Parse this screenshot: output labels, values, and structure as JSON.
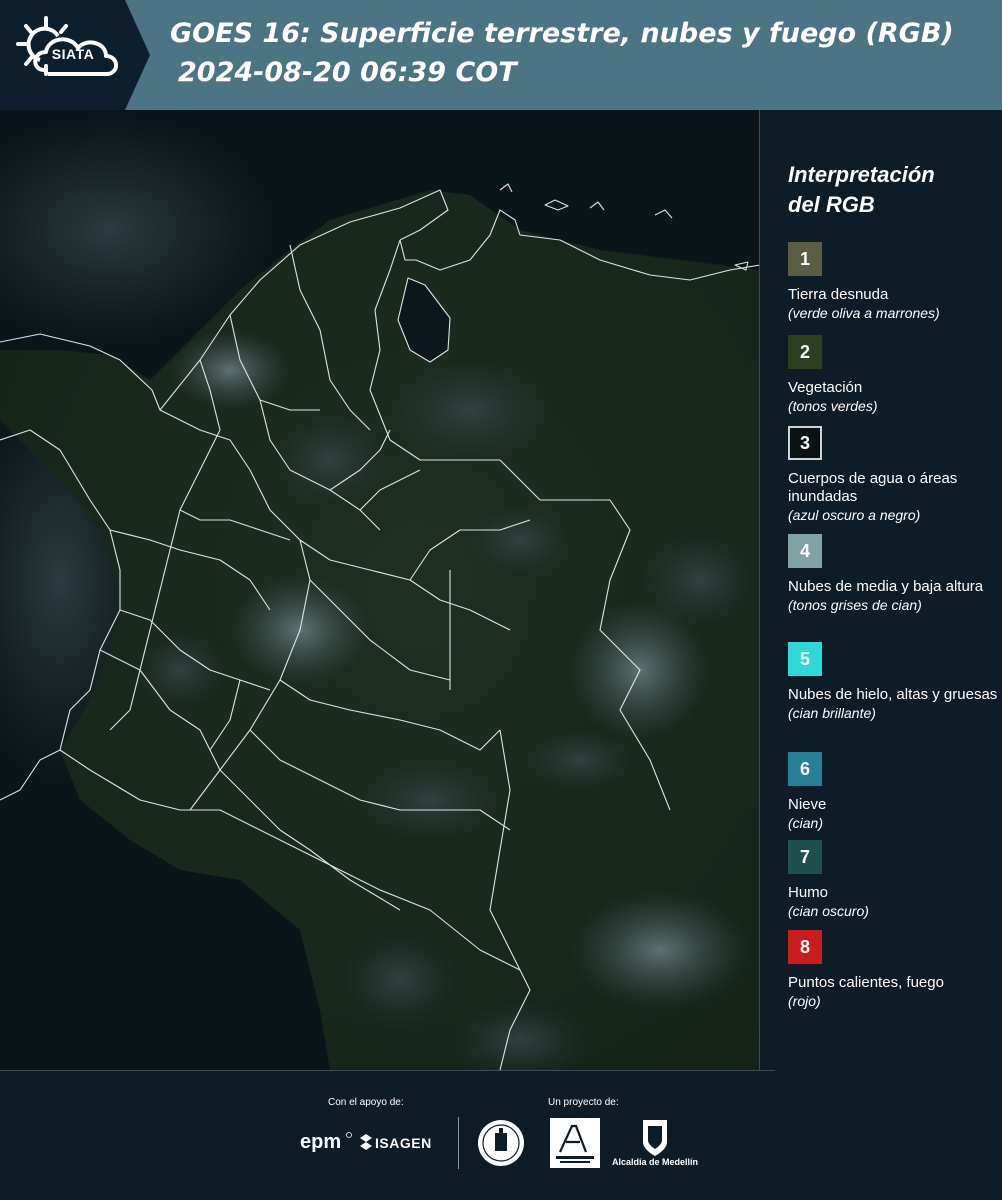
{
  "header": {
    "logo_text": "SIATA",
    "title": "GOES 16: Superficie terrestre, nubes y fuego (RGB)",
    "datetime": "2024-08-20 06:39 COT"
  },
  "map": {
    "icon": "colombia-satellite-map"
  },
  "legend": {
    "title_line1": "Interpretación",
    "title_line2": "del RGB",
    "items": [
      {
        "number": "1",
        "color": "#5b5c44",
        "label": "Tierra desnuda",
        "desc": "(verde oliva a marrones)"
      },
      {
        "number": "2",
        "color": "#2c3f1f",
        "label": "Vegetación",
        "desc": "(tonos verdes)"
      },
      {
        "number": "3",
        "color": "#0a1216",
        "label": "Cuerpos de agua o áreas inundadas",
        "desc": "(azul oscuro a negro)"
      },
      {
        "number": "4",
        "color": "#7fa3a3",
        "label": "Nubes de media y baja altura",
        "desc": "(tonos grises de cian)"
      },
      {
        "number": "5",
        "color": "#2ed8d8",
        "label": "Nubes de hielo, altas y gruesas",
        "desc": "(cian brillante)"
      },
      {
        "number": "6",
        "color": "#258097",
        "label": "Nieve",
        "desc": "(cian)"
      },
      {
        "number": "7",
        "color": "#1f5050",
        "label": "Humo",
        "desc": "(cian oscuro)"
      },
      {
        "number": "8",
        "color": "#c81d1d",
        "label": "Puntos calientes, fuego",
        "desc": "(rojo)"
      }
    ]
  },
  "footer": {
    "support_label": "Con el apoyo de:",
    "project_label": "Un proyecto de:",
    "epm": "epm",
    "isagen": "ISAGEN",
    "alcaldia": "Alcaldía de Medellín"
  }
}
